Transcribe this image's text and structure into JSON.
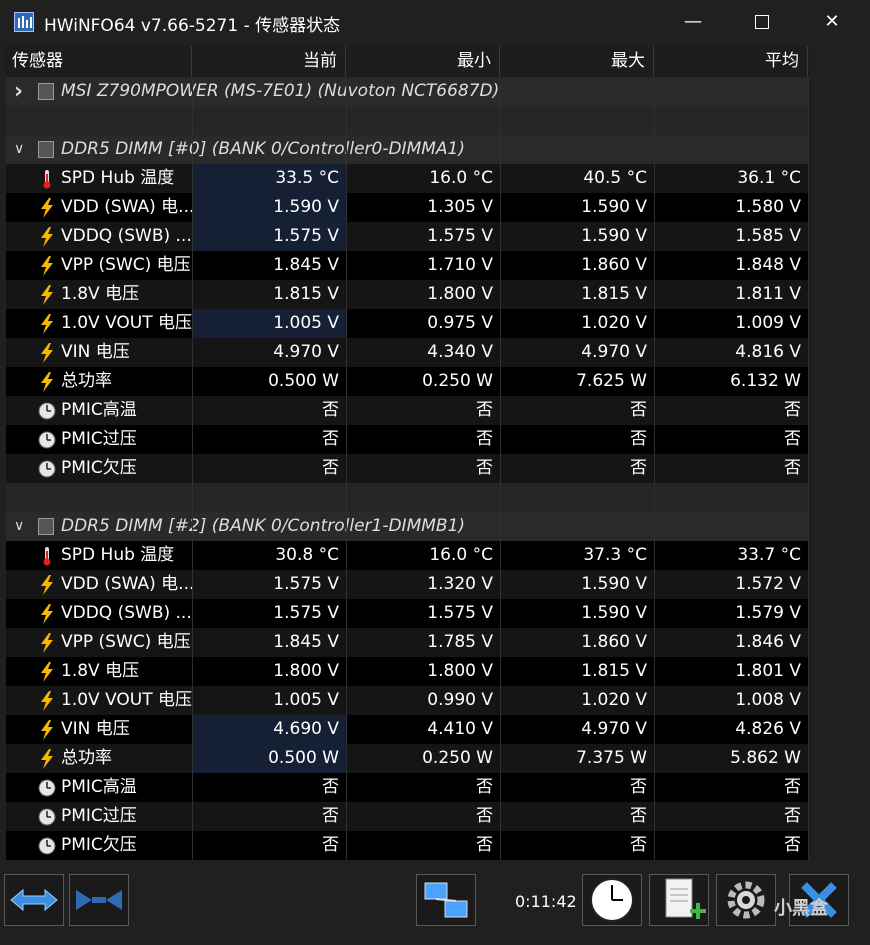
{
  "window": {
    "title": "HWiNFO64 v7.66-5271 - 传感器状态",
    "minimize_icon": "minimize-icon",
    "maximize_icon": "maximize-icon",
    "close_icon": "close-icon"
  },
  "columns": [
    "传感器",
    "当前",
    "最小",
    "最大",
    "平均"
  ],
  "rows": [
    {
      "type": "group",
      "expanded": false,
      "title": "MSI Z790MPOWER (MS-7E01) (Nuvoton NCT6687D)"
    },
    {
      "type": "blank"
    },
    {
      "type": "group",
      "expanded": true,
      "title": "DDR5 DIMM [#0] (BANK 0/Controller0-DIMMA1)"
    },
    {
      "type": "sensor",
      "icon": "thermometer-icon",
      "name": "SPD Hub 温度",
      "values": [
        "33.5 °C",
        "16.0 °C",
        "40.5 °C",
        "36.1 °C"
      ],
      "highlight": true
    },
    {
      "type": "sensor",
      "icon": "lightning-icon",
      "name": "VDD (SWA) 电...",
      "values": [
        "1.590 V",
        "1.305 V",
        "1.590 V",
        "1.580 V"
      ],
      "highlight": true
    },
    {
      "type": "sensor",
      "icon": "lightning-icon",
      "name": "VDDQ (SWB) ...",
      "values": [
        "1.575 V",
        "1.575 V",
        "1.590 V",
        "1.585 V"
      ],
      "highlight": true
    },
    {
      "type": "sensor",
      "icon": "lightning-icon",
      "name": "VPP (SWC) 电压",
      "values": [
        "1.845 V",
        "1.710 V",
        "1.860 V",
        "1.848 V"
      ],
      "highlight": false
    },
    {
      "type": "sensor",
      "icon": "lightning-icon",
      "name": "1.8V 电压",
      "values": [
        "1.815 V",
        "1.800 V",
        "1.815 V",
        "1.811 V"
      ],
      "highlight": false
    },
    {
      "type": "sensor",
      "icon": "lightning-icon",
      "name": "1.0V VOUT 电压",
      "values": [
        "1.005 V",
        "0.975 V",
        "1.020 V",
        "1.009 V"
      ],
      "highlight": true
    },
    {
      "type": "sensor",
      "icon": "lightning-icon",
      "name": "VIN 电压",
      "values": [
        "4.970 V",
        "4.340 V",
        "4.970 V",
        "4.816 V"
      ],
      "highlight": false
    },
    {
      "type": "sensor",
      "icon": "lightning-icon",
      "name": "总功率",
      "values": [
        "0.500 W",
        "0.250 W",
        "7.625 W",
        "6.132 W"
      ],
      "highlight": false
    },
    {
      "type": "sensor",
      "icon": "clock-icon",
      "name": "PMIC高温",
      "values": [
        "否",
        "否",
        "否",
        "否"
      ],
      "highlight": false
    },
    {
      "type": "sensor",
      "icon": "clock-icon",
      "name": "PMIC过压",
      "values": [
        "否",
        "否",
        "否",
        "否"
      ],
      "highlight": false
    },
    {
      "type": "sensor",
      "icon": "clock-icon",
      "name": "PMIC欠压",
      "values": [
        "否",
        "否",
        "否",
        "否"
      ],
      "highlight": false
    },
    {
      "type": "blank"
    },
    {
      "type": "group",
      "expanded": true,
      "title": "DDR5 DIMM [#2] (BANK 0/Controller1-DIMMB1)"
    },
    {
      "type": "sensor",
      "icon": "thermometer-icon",
      "name": "SPD Hub 温度",
      "values": [
        "30.8 °C",
        "16.0 °C",
        "37.3 °C",
        "33.7 °C"
      ],
      "highlight": false
    },
    {
      "type": "sensor",
      "icon": "lightning-icon",
      "name": "VDD (SWA) 电...",
      "values": [
        "1.575 V",
        "1.320 V",
        "1.590 V",
        "1.572 V"
      ],
      "highlight": false
    },
    {
      "type": "sensor",
      "icon": "lightning-icon",
      "name": "VDDQ (SWB) ...",
      "values": [
        "1.575 V",
        "1.575 V",
        "1.590 V",
        "1.579 V"
      ],
      "highlight": false
    },
    {
      "type": "sensor",
      "icon": "lightning-icon",
      "name": "VPP (SWC) 电压",
      "values": [
        "1.845 V",
        "1.785 V",
        "1.860 V",
        "1.846 V"
      ],
      "highlight": false
    },
    {
      "type": "sensor",
      "icon": "lightning-icon",
      "name": "1.8V 电压",
      "values": [
        "1.800 V",
        "1.800 V",
        "1.815 V",
        "1.801 V"
      ],
      "highlight": false
    },
    {
      "type": "sensor",
      "icon": "lightning-icon",
      "name": "1.0V VOUT 电压",
      "values": [
        "1.005 V",
        "0.990 V",
        "1.020 V",
        "1.008 V"
      ],
      "highlight": false
    },
    {
      "type": "sensor",
      "icon": "lightning-icon",
      "name": "VIN 电压",
      "values": [
        "4.690 V",
        "4.410 V",
        "4.970 V",
        "4.826 V"
      ],
      "highlight": true
    },
    {
      "type": "sensor",
      "icon": "lightning-icon",
      "name": "总功率",
      "values": [
        "0.500 W",
        "0.250 W",
        "7.375 W",
        "5.862 W"
      ],
      "highlight": true
    },
    {
      "type": "sensor",
      "icon": "clock-icon",
      "name": "PMIC高温",
      "values": [
        "否",
        "否",
        "否",
        "否"
      ],
      "highlight": false
    },
    {
      "type": "sensor",
      "icon": "clock-icon",
      "name": "PMIC过压",
      "values": [
        "否",
        "否",
        "否",
        "否"
      ],
      "highlight": false
    },
    {
      "type": "sensor",
      "icon": "clock-icon",
      "name": "PMIC欠压",
      "values": [
        "否",
        "否",
        "否",
        "否"
      ],
      "highlight": false
    }
  ],
  "toolbar": {
    "timer": "0:11:42",
    "buttons": [
      "expand-arrows-icon",
      "collapse-arrows-icon",
      "network-icon",
      "clock-icon",
      "add-report-icon",
      "settings-gear-icon",
      "reset-icon"
    ]
  },
  "watermark": "小黑盒",
  "colors": {
    "highlight": "#152035",
    "background": "#000000",
    "alt_row": "#151515",
    "group_row": "#2a2a2a"
  }
}
